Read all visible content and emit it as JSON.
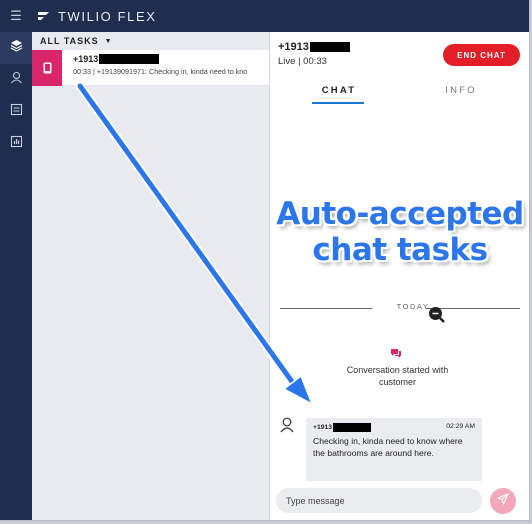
{
  "app": {
    "brand": "TWILIO FLEX",
    "menu_icon": "hamburger-icon",
    "logo_icon": "twilio-flex-logo-icon"
  },
  "sidebar": {
    "items": [
      {
        "name": "layers-icon",
        "active": true
      },
      {
        "name": "agents-icon",
        "active": false
      },
      {
        "name": "queues-icon",
        "active": false
      },
      {
        "name": "insights-icon",
        "active": false
      }
    ]
  },
  "tasklist": {
    "header": "ALL TASKS",
    "tasks": [
      {
        "title": "+1913",
        "subtitle": "00:33 | +19139091971: Checking in, kinda need to kno",
        "icon": "chat-task-icon",
        "color": "#d9266a"
      }
    ]
  },
  "chat": {
    "phone": "+1913",
    "status": "Live | 00:33",
    "end_chat_label": "END CHAT",
    "tabs": [
      {
        "label": "CHAT",
        "active": true
      },
      {
        "label": "INFO",
        "active": false
      }
    ],
    "date_divider": "TODAY",
    "conversation_started": "Conversation started with customer",
    "message": {
      "sender": "+1913",
      "time": "02:29 AM",
      "body": "Checking in, kinda need to know where the bathrooms are around here."
    },
    "composer_placeholder": "Type message"
  },
  "annotation": {
    "callout_line1": "Auto-accepted",
    "callout_line2": "chat tasks"
  },
  "colors": {
    "nav_bg": "#1f2d4e",
    "accent_pink": "#d9266a",
    "end_chat_red": "#e31e26",
    "tab_blue": "#1976d2",
    "annotation_blue": "#2b76ec"
  }
}
